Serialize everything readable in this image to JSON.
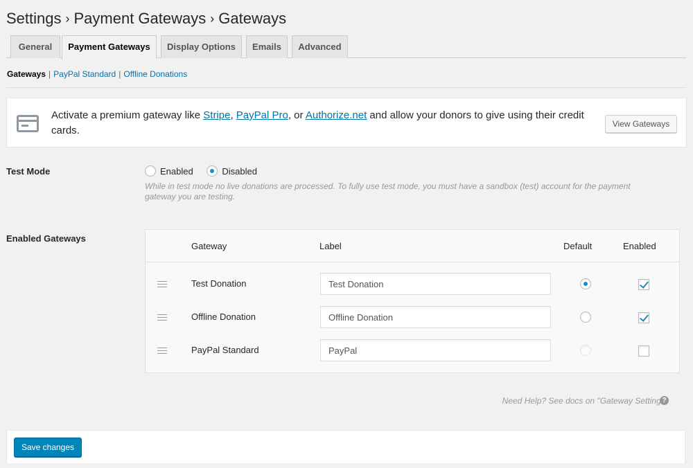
{
  "breadcrumb": [
    "Settings",
    "Payment Gateways",
    "Gateways"
  ],
  "breadcrumb_separator": "›",
  "tabs": [
    {
      "label": "General",
      "active": false
    },
    {
      "label": "Payment Gateways",
      "active": true
    },
    {
      "label": "Display Options",
      "active": false
    },
    {
      "label": "Emails",
      "active": false
    },
    {
      "label": "Advanced",
      "active": false
    }
  ],
  "subnav": {
    "current": "Gateways",
    "links": [
      "PayPal Standard",
      "Offline Donations"
    ],
    "separator": "|"
  },
  "notice": {
    "text_before": "Activate a premium gateway like ",
    "link1": "Stripe",
    "sep1": ", ",
    "link2": "PayPal Pro",
    "sep2": ", or ",
    "link3": "Authorize.net",
    "text_after": " and allow your donors to give using their credit cards.",
    "button": "View Gateways",
    "icon": "credit-card-icon"
  },
  "test_mode": {
    "label": "Test Mode",
    "options": [
      "Enabled",
      "Disabled"
    ],
    "selected": "Disabled",
    "description": "While in test mode no live donations are processed. To fully use test mode, you must have a sandbox (test) account for the payment gateway you are testing."
  },
  "gateways": {
    "label": "Enabled Gateways",
    "columns": {
      "gateway": "Gateway",
      "label": "Label",
      "default": "Default",
      "enabled": "Enabled"
    },
    "rows": [
      {
        "name": "Test Donation",
        "label": "Test Donation",
        "default": true,
        "default_disabled": false,
        "enabled": true
      },
      {
        "name": "Offline Donation",
        "label": "Offline Donation",
        "default": false,
        "default_disabled": false,
        "enabled": true
      },
      {
        "name": "PayPal Standard",
        "label": "PayPal",
        "default": false,
        "default_disabled": true,
        "enabled": false
      }
    ]
  },
  "help": {
    "text": "Need Help? See docs on \"Gateway Settings\"",
    "icon": "?"
  },
  "footer": {
    "save_button": "Save changes"
  },
  "colors": {
    "accent": "#0085ba",
    "link": "#0073aa",
    "radio_dot": "#1e8cbe"
  }
}
